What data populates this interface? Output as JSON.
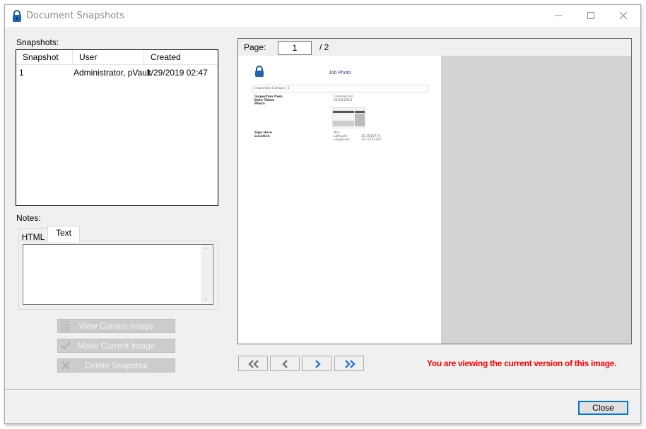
{
  "window": {
    "title": "Document Snapshots",
    "icon": "padlock-icon",
    "controls": [
      "minimize-icon",
      "maximize-icon",
      "close-icon"
    ]
  },
  "snapshots": {
    "label": "Snapshots:",
    "columns": [
      "Snapshot",
      "User",
      "Created"
    ],
    "rows": [
      {
        "snapshot": "1",
        "user": "Administrator, pVault",
        "created": "1/29/2019 02:47"
      }
    ]
  },
  "notes": {
    "label": "Notes:",
    "tabs": [
      {
        "label": "HTML",
        "active": false
      },
      {
        "label": "Text",
        "active": true
      }
    ],
    "value": ""
  },
  "actions": {
    "view_current": {
      "label": "View Current Image",
      "icon": "magnifier-page-icon",
      "enabled": false
    },
    "make_current": {
      "label": "Make Current Image",
      "icon": "checkmark-icon",
      "enabled": false
    },
    "delete_snapshot": {
      "label": "Delete Snapshot",
      "icon": "x-icon",
      "enabled": false
    }
  },
  "viewer": {
    "page_label": "Page:",
    "page_current": "1",
    "page_total": "/ 2",
    "document": {
      "title": "Job Photo",
      "section": "Inspection Category 1",
      "fields": [
        {
          "label": "Inspection Item",
          "value": "Commercial"
        },
        {
          "label": "Date Taken",
          "value": "04/23/2018"
        },
        {
          "label": "Photo",
          "value": ""
        },
        {
          "label": "Sign Here",
          "value": "N/A"
        },
        {
          "label": "Location",
          "value": ""
        }
      ],
      "location": [
        {
          "label": "Latitude:",
          "value": "30.3650774"
        },
        {
          "label": "Longitude:",
          "value": "-91.0752115"
        }
      ]
    }
  },
  "navigation": {
    "first": "double-chevron-left-icon",
    "prev": "chevron-left-icon",
    "next": "chevron-right-icon",
    "last": "double-chevron-right-icon"
  },
  "status": {
    "message": "You are viewing the current version of this image.",
    "color": "#ff0000"
  },
  "footer": {
    "close_label": "Close",
    "accent": "#0078d7"
  }
}
